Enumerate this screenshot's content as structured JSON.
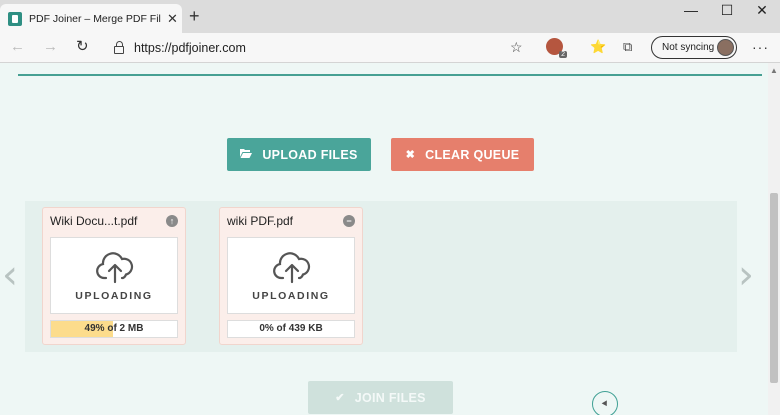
{
  "browser": {
    "tab_title": "PDF Joiner – Merge PDF Files Or",
    "tab_close": "✕",
    "new_tab": "+",
    "url": "https://pdfjoiner.com",
    "sync_label": "Not syncing",
    "window": {
      "minimize": "—",
      "maximize": "☐",
      "close": "✕"
    },
    "nav": {
      "back": "←",
      "forward": "→",
      "refresh": "↻"
    },
    "icons": {
      "star": "☆",
      "favorites": "⭐",
      "collections": "⧉",
      "menu": "···"
    }
  },
  "page": {
    "upload_button": "UPLOAD FILES",
    "clear_button": "CLEAR QUEUE",
    "join_button": "JOIN FILES",
    "prev_arrow": "‹",
    "next_arrow": "›",
    "files": [
      {
        "name": "Wiki Docu...t.pdf",
        "status": "UPLOADING",
        "progress_text": "49% of 2 MB",
        "progress": 49,
        "action_icon": "↑"
      },
      {
        "name": "wiki PDF.pdf",
        "status": "UPLOADING",
        "progress_text": "0% of 439 KB",
        "progress": 0,
        "action_icon": "−"
      }
    ]
  },
  "colors": {
    "accent": "#4aa59a",
    "danger": "#e67f6c",
    "progress_fill": "#fcdc8c"
  }
}
